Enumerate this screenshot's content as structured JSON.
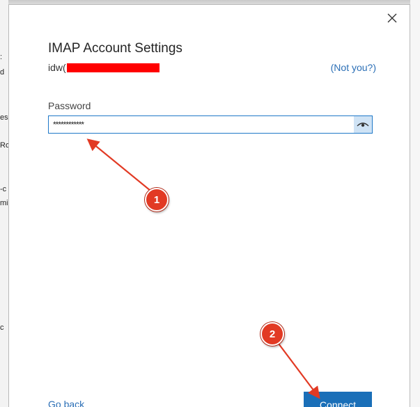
{
  "dialog": {
    "title": "IMAP Account Settings",
    "email_visible": "idw(",
    "not_you_label": "(Not you?)",
    "close_glyph": "✕",
    "password_label": "Password",
    "password_value": "************",
    "go_back_label": "Go back",
    "connect_label": "Connect"
  },
  "background": {
    "left_fragments": [
      ":",
      "d",
      "es",
      "Ro",
      "-c",
      "mi",
      "c"
    ]
  },
  "annotations": [
    {
      "label": "1"
    },
    {
      "label": "2"
    }
  ],
  "colors": {
    "accent": "#1a6fb8",
    "link": "#2b6fb6",
    "redaction": "#ff0000",
    "annotation": "#e23a24"
  },
  "icons": {
    "close": "close-icon",
    "reveal": "eye-icon"
  }
}
